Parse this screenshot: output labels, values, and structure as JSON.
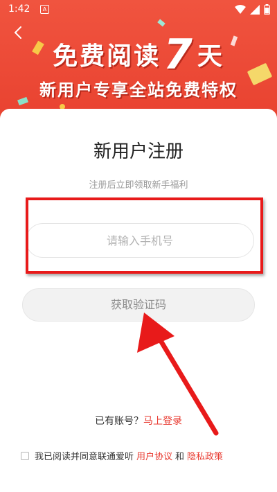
{
  "status_bar": {
    "time": "1:42",
    "notification_letter": "A"
  },
  "banner": {
    "title_prefix": "免费阅读",
    "title_number": "7",
    "title_suffix": "天",
    "subtitle": "新用户专享全站免费特权"
  },
  "form": {
    "title": "新用户注册",
    "subtitle": "注册后立即领取新手福利",
    "phone_placeholder": "请输入手机号",
    "get_code_label": "获取验证码"
  },
  "login": {
    "prompt": "已有账号？",
    "link": "马上登录"
  },
  "agreement": {
    "text": "我已阅读并同意联通爱听",
    "user_agreement": "用户协议",
    "and": "和",
    "privacy_policy": "隐私政策",
    "checked": false
  },
  "colors": {
    "banner_red": "#e8412f",
    "accent_red": "#e8392f",
    "highlight_red": "#e81a1a"
  }
}
